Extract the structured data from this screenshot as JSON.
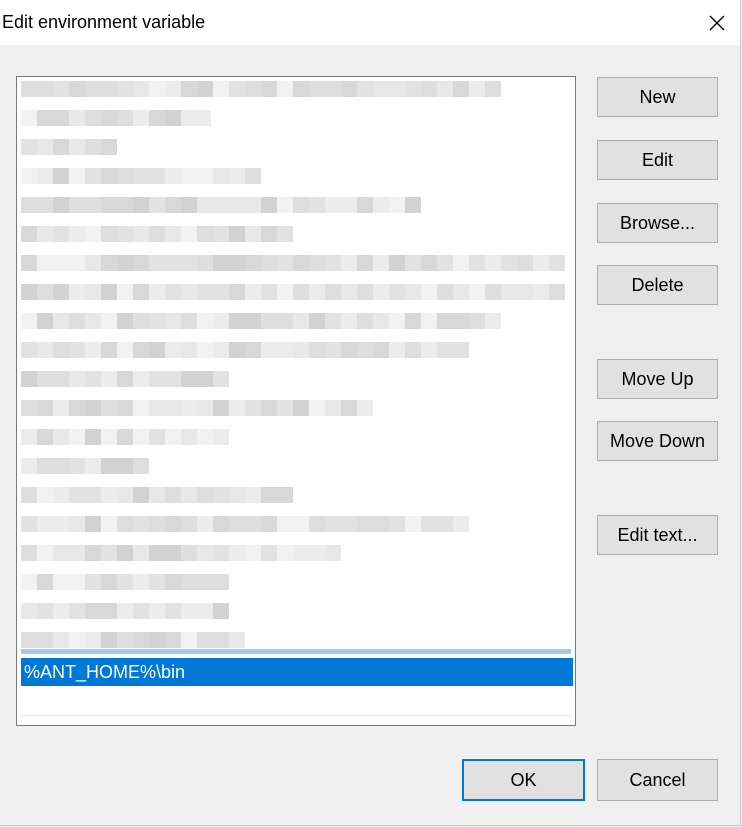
{
  "window": {
    "title": "Edit environment variable"
  },
  "list": {
    "selected_entry": "%ANT_HOME%\\bin"
  },
  "buttons": {
    "new": "New",
    "edit": "Edit",
    "browse": "Browse...",
    "delete": "Delete",
    "move_up": "Move Up",
    "move_down": "Move Down",
    "edit_text": "Edit text...",
    "ok": "OK",
    "cancel": "Cancel"
  },
  "icons": {
    "close": "close-icon"
  },
  "colors": {
    "selection": "#0078d7",
    "dialog_bg": "#f0f0f0",
    "button_bg": "#e1e1e1"
  }
}
